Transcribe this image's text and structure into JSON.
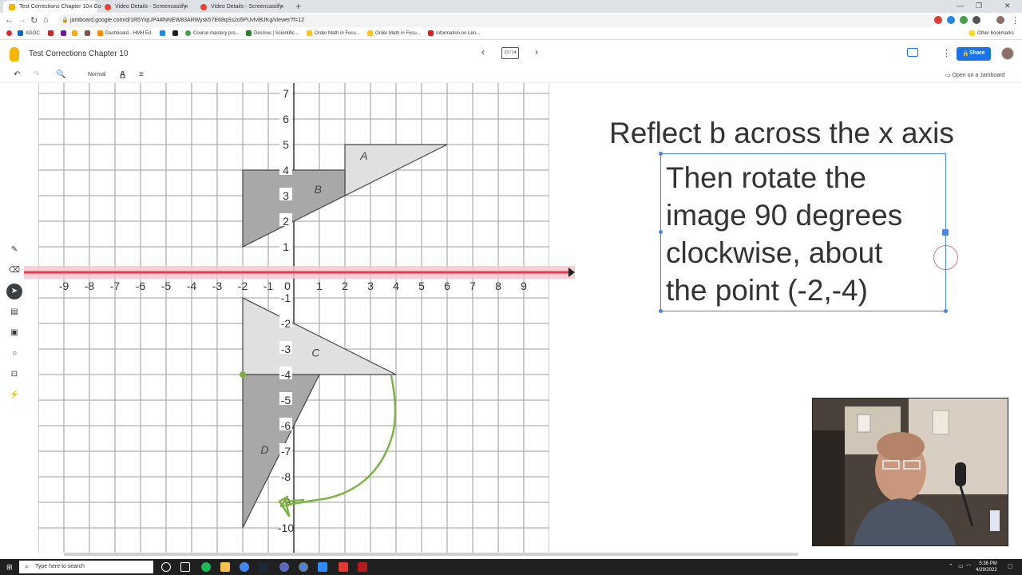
{
  "browser": {
    "tabs": [
      {
        "label": "Test Corrections Chapter 10 - Go",
        "active": true
      },
      {
        "label": "Video Details - Screencastify",
        "active": false
      },
      {
        "label": "Video Details - Screencastify",
        "active": false
      }
    ],
    "new_tab": "+",
    "url": "jamboard.google.com/d/1R5YiqUP44lNNEW83ARWysk57E68qSs2o5PUvlviBJKg/viewer?f=12",
    "bookmarks": [
      "AGOC",
      "Dashboard - HMH Ed",
      "Course mastery pro...",
      "Desmos | Scientific...",
      "Order Math in Focu...",
      "Order Math in Focu...",
      "Information on Len..."
    ],
    "other_bookmarks": "Other bookmarks"
  },
  "app": {
    "title": "Test Corrections Chapter 10",
    "frame_indicator": "13 / 14",
    "share_label": "Share",
    "open_jamboard": "Open on a Jamboard",
    "zoom_label": "Normal"
  },
  "canvas": {
    "heading": "Reflect b across the x axis",
    "instruction": "Then rotate the\nimage 90 degrees\nclockwise, about\nthe point (-2,-4)"
  },
  "graph": {
    "x_ticks": [
      "-9",
      "-8",
      "-7",
      "-6",
      "-5",
      "-4",
      "-3",
      "-2",
      "-1",
      "0",
      "1",
      "2",
      "3",
      "4",
      "5",
      "6",
      "7",
      "8",
      "9"
    ],
    "y_ticks_pos": [
      "7",
      "6",
      "5",
      "4",
      "3",
      "2",
      "1"
    ],
    "y_ticks_neg": [
      "-1",
      "-2",
      "-3",
      "-4",
      "-5",
      "-6",
      "-7",
      "-8",
      "-9",
      "-10"
    ],
    "shape_labels": [
      "A",
      "B",
      "C",
      "D"
    ]
  },
  "taskbar": {
    "search_placeholder": "Type here to search",
    "time": "5:36 PM",
    "date": "4/29/2022"
  },
  "icons": {
    "undo": "undo-icon",
    "redo": "redo-icon",
    "zoom": "zoom-icon",
    "text-color": "text-color-icon",
    "align": "align-icon",
    "pen": "pen-icon",
    "eraser": "eraser-icon",
    "select": "select-icon",
    "sticky": "sticky-note-icon",
    "image": "image-icon",
    "circle": "shape-icon",
    "textbox": "textbox-icon",
    "laser": "laser-icon"
  },
  "colors": {
    "accent": "#1a73e8",
    "selection": "#4a86e8",
    "green_ink": "#7cb342",
    "laser": "#e53950"
  }
}
